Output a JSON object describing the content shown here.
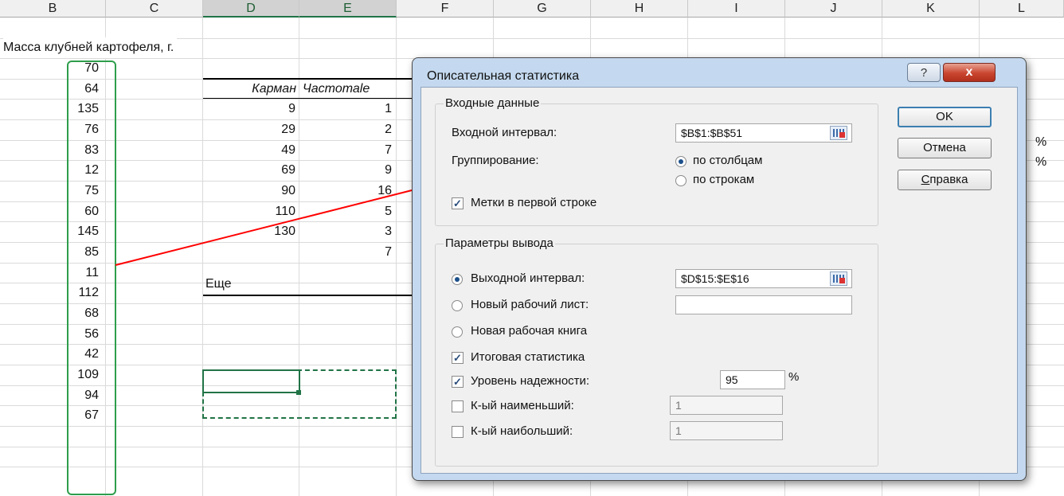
{
  "columns": [
    "B",
    "C",
    "D",
    "E",
    "F",
    "G",
    "H",
    "I",
    "J",
    "K",
    "L"
  ],
  "sheet": {
    "header_text": "Масса клубней картофеля, г.",
    "values": [
      "70",
      "64",
      "135",
      "76",
      "83",
      "12",
      "75",
      "60",
      "145",
      "85",
      "11",
      "112",
      "68",
      "56",
      "42",
      "109",
      "94",
      "67"
    ],
    "table_headers": [
      "Карман",
      "Частотаle"
    ],
    "bins": [
      "9",
      "29",
      "49",
      "69",
      "90",
      "110",
      "130",
      "Еще"
    ],
    "frequencies": [
      "1",
      "2",
      "7",
      "9",
      "16",
      "5",
      "3",
      "7"
    ],
    "edge_marks": [
      "%",
      "%"
    ]
  },
  "dialog": {
    "title": "Описательная статистика",
    "help_label": "?",
    "close_label": "x",
    "input_group": {
      "label": "Входные данные",
      "range_label": "Входной интервал:",
      "range_value": "$B$1:$B$51",
      "grouping_label": "Группирование:",
      "by_columns": "по столбцам",
      "by_rows": "по строкам",
      "labels_first_row": "Метки в первой строке"
    },
    "output_group": {
      "label": "Параметры вывода",
      "output_range": "Выходной интервал:",
      "output_range_value": "$D$15:$E$16",
      "new_sheet": "Новый рабочий лист:",
      "new_workbook": "Новая рабочая книга",
      "summary_stats": "Итоговая статистика",
      "confidence_level": "Уровень надежности:",
      "confidence_value": "95",
      "percent": "%",
      "kth_smallest": "К-ый наименьший:",
      "kth_smallest_value": "1",
      "kth_largest": "К-ый наибольший:",
      "kth_largest_value": "1"
    },
    "buttons": {
      "ok": "OK",
      "cancel": "Отмена",
      "help": "Справка"
    }
  },
  "colors": {
    "arrow": "#ff0000",
    "selection": "#217346",
    "dialog_frame": "#c4d9ef"
  }
}
